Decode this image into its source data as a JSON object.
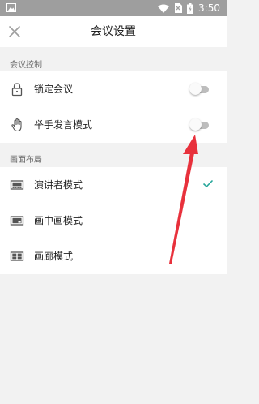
{
  "status_bar": {
    "time": "3:50"
  },
  "header": {
    "title": "会议设置"
  },
  "meeting_control": {
    "section_title": "会议控制",
    "items": [
      {
        "label": "锁定会议",
        "enabled": false
      },
      {
        "label": "举手发言模式",
        "enabled": false
      }
    ]
  },
  "layout": {
    "section_title": "画面布局",
    "items": [
      {
        "label": "演讲者模式",
        "selected": true
      },
      {
        "label": "画中画模式",
        "selected": false
      },
      {
        "label": "画廊模式",
        "selected": false
      }
    ]
  },
  "colors": {
    "accent": "#26a69a",
    "annotation_arrow": "#e8313c",
    "status_bar": "#9e9e9e"
  }
}
